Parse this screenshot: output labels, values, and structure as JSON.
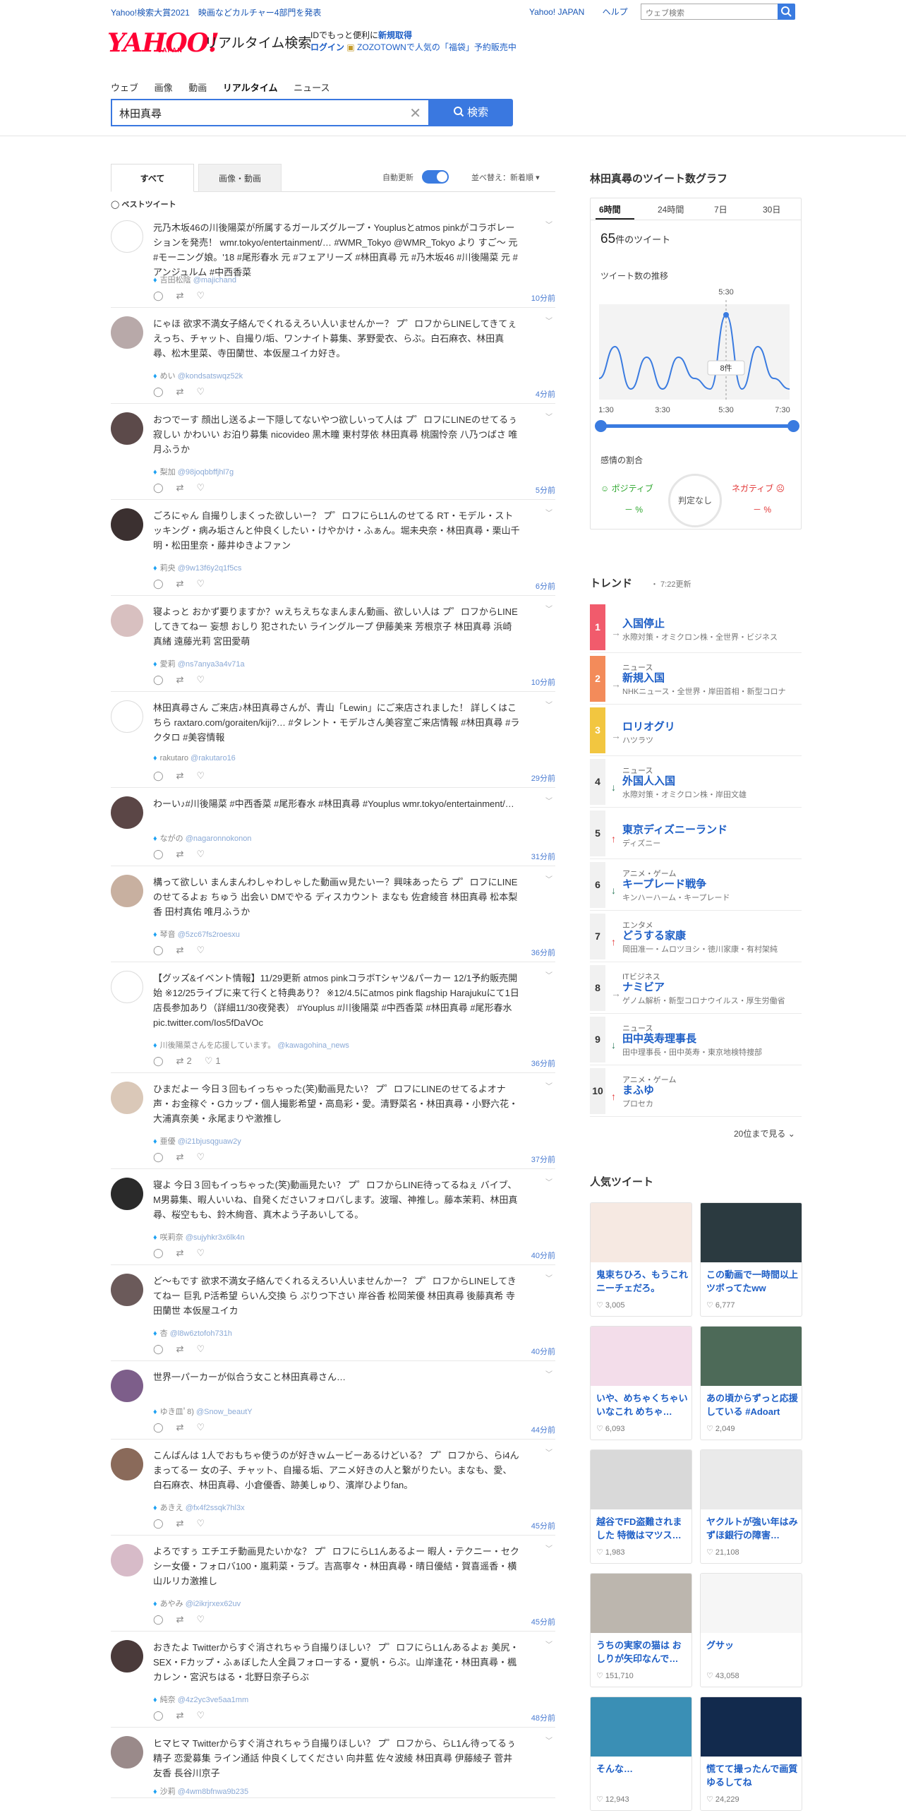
{
  "top": {
    "promo_link": "Yahoo!検索大賞2021　映画などカルチャー4部門を発表",
    "links": [
      "Yahoo! JAPAN",
      "ヘルプ"
    ],
    "web_search_placeholder": "ウェブ検索"
  },
  "header": {
    "logo_text": "YAHOO!",
    "logo_sub": "JAPAN",
    "service_name": "リアルタイム検索",
    "promo_line1": "IDでもっと便利に",
    "promo_line1_link": "新規取得",
    "promo_line2_link": "ログイン",
    "promo_line2": "ZOZOTOWNで人気の「福袋」予約販売中"
  },
  "nav": {
    "tabs": [
      "ウェブ",
      "画像",
      "動画",
      "リアルタイム",
      "ニュース"
    ],
    "active": "リアルタイム"
  },
  "search": {
    "query": "林田真尋",
    "button_label": "検索"
  },
  "feed_controls": {
    "tab_all": "すべて",
    "tab_media": "画像・動画",
    "auto_update": "自動更新",
    "sort": "並べ替え：新着順",
    "best_tweet": "ベストツイート"
  },
  "tweets": [
    {
      "text": "元乃木坂46の川後陽菜が所属するガールズグループ・Youplusとatmos pinkがコラボレーションを発売！ wmr.tokyo/entertainment/… #WMR_Tokyo @WMR_Tokyo より すご～ 元 #モーニング娘。'18 #尾形春水 元 #フェアリーズ #林田真尋 元 #乃木坂46 #川後陽菜 元 #アンジュルム #中西香菜",
      "user": "吉田松陰",
      "screen": "@majichand",
      "time": "10分前",
      "rt": "",
      "like": ""
    },
    {
      "text": "にゃほ 欲求不満女子絡んでくれるえろい人いませんかー？ プ゜ロフからLINEしてきてぇ えっち、チャット、自撮り/垢、ワンナイト募集、茅野愛衣、らぶ。白石麻衣、林田真尋、松木里菜、寺田蘭世、本仮屋ユイカ好き。",
      "user": "めい",
      "screen": "@kondsatswqz52k",
      "time": "4分前",
      "rt": "",
      "like": ""
    },
    {
      "text": "おつでーす 顔出し送るよー下隠してないやつ欲しいって人は プ゜ロフにLINEのせてるぅ 寂しい かわいい お泊り募集 nicovideo 黒木瞳 東村芽依 林田真尋 桃園怜奈 八乃つばさ 唯月ふうか",
      "user": "梨加",
      "screen": "@98joqbbffjhl7g",
      "time": "5分前",
      "rt": "",
      "like": ""
    },
    {
      "text": "ごろにゃん 自撮りしまくった欲しいー？ プ゜ロフにらL1んのせてる RT・モデル・ストッキング・病み垢さんと仲良くしたい・けやかけ・ふぁん。堀未央奈・林田真尋・栗山千明・松田里奈・藤井ゆきよファン",
      "user": "莉央",
      "screen": "@9w13f6y2q1f5cs",
      "time": "6分前",
      "rt": "",
      "like": ""
    },
    {
      "text": "寝よっと おかず要りますか？ｗえちえちなまんまん動画、欲しい人は プ゜ロフからLINEしてきてねー 妄想 おしり 犯されたい ライングループ 伊藤美来 芳根京子 林田真尋 浜崎真緒 遠藤光莉 宮田愛萌",
      "user": "愛莉",
      "screen": "@ns7anya3a4v71a",
      "time": "10分前",
      "rt": "",
      "like": ""
    },
    {
      "text": "林田真尋さん ご来店♪林田真尋さんが、青山「Lewin」にご来店されました！ 詳しくはこちら raxtaro.com/goraiten/kiji?… #タレント・モデルさん美容室ご来店情報 #林田真尋 #ラクタロ #美容情報",
      "user": "rakutaro",
      "screen": "@rakutaro16",
      "time": "29分前",
      "rt": "",
      "like": ""
    },
    {
      "text": "わーい♪#川後陽菜 #中西香菜 #尾形春水 #林田真尋 #Youplus wmr.tokyo/entertainment/…",
      "user": "ながの",
      "screen": "@nagaronnokonon",
      "time": "31分前",
      "rt": "",
      "like": ""
    },
    {
      "text": "構って欲しい まんまんわしゃわしゃした動画ｗ見たいー？興味あったら プ゜ロフにLINEのせてるよぉ ちゅう 出会い DMでやる ディスカウント まなも 佐倉綾音 林田真尋 松本梨香 田村真佑 唯月ふうか",
      "user": "琴音",
      "screen": "@5zc67fs2roesxu",
      "time": "36分前",
      "rt": "",
      "like": ""
    },
    {
      "text": "【グッズ&イベント情報】11/29更新 atmos pinkコラボTシャツ&パーカー 12/1予約販売開始 ※12/25ライブに来て行くと特典あり？ ※12/4.5にatmos pink flagship Harajukuにて1日店長参加あり（詳細11/30夜発表） #Youplus #川後陽菜 #中西香菜 #林田真尋 #尾形春水 pic.twitter.com/Ios5fDaVOc",
      "user": "川後陽菜さんを応援しています。",
      "screen": "@kawagohina_news",
      "time": "36分前",
      "rt": "2",
      "like": "1"
    },
    {
      "text": "ひまだよー 今日３回もイっちゃった(笑)動画見たい？ プ゜ロフにLINEのせてるよオナ声・お金稼ぐ・Gカップ・個人撮影希望・高島彩・愛。清野菜名・林田真尋・小野六花・大浦真奈美・永尾まりや激推し",
      "user": "亜優",
      "screen": "@i21bjusqguaw2y",
      "time": "37分前",
      "rt": "",
      "like": ""
    },
    {
      "text": "寝よ 今日３回もイっちゃった(笑)動画見たい？ プ゜ロフからLINE待ってるねぇ バイブ、M男募集、暇人いいね、自発くださいフォロバします。波瑠、神推し。藤本茉莉、林田真尋、桜空もも、鈴木絢音、真木よう子あいしてる。",
      "user": "咲莉奈",
      "screen": "@sujyhkr3x6lk4n",
      "time": "40分前",
      "rt": "",
      "like": ""
    },
    {
      "text": "ど～もです 欲求不満女子絡んでくれるえろい人いませんかー？ プ゜ロフからLINEしてきてねー 巨乳 P活希望 らいん交換 ら ぷりつ下さい 岸谷香 松岡茉優 林田真尋 後藤真希 寺田蘭世 本仮屋ユイカ",
      "user": "杏",
      "screen": "@l8w6ztofoh731h",
      "time": "40分前",
      "rt": "",
      "like": ""
    },
    {
      "text": "世界一パーカーが似合う女こと林田真尋さん…",
      "user": "ゆき皿ﾟ8)",
      "screen": "@Snow_beautY",
      "time": "44分前",
      "rt": "",
      "like": ""
    },
    {
      "text": "こんばんは 1人でおもちゃ使うのが好きｗムービーあるけどいる？ プ゜ロフから、らi4んまってるー 女の子、チャット、自撮る垢、アニメ好きの人と繋がりたい。まなも、愛、白石麻衣、林田真尋、小倉優香、跡美しゅり、濱岸ひよりfan。",
      "user": "あきえ",
      "screen": "@fx4f2ssqk7hl3x",
      "time": "45分前",
      "rt": "",
      "like": ""
    },
    {
      "text": "よろですぅ エチエチ動画見たいかな？ プ゜ロフにらL1んあるよー 暇人・テクニー・セクシー女優・フォロバ100・嵐莉菜・ラブ。吉高寧々・林田真尋・晴日優結・賀喜遥香・横山ルリカ激推し",
      "user": "あやみ",
      "screen": "@i2ikrjrxex62uv",
      "time": "45分前",
      "rt": "",
      "like": ""
    },
    {
      "text": "おきたよ Twitterからすぐ消されちゃう自撮りほしい？ プ゜ロフにらL1んあるよぉ 美尻・SEX・Fカップ・ふぁぼした人全員フォローする・夏帆・らぶ。山岸逢花・林田真尋・楓カレン・宮沢ちはる・北野日奈子らぶ",
      "user": "純奈",
      "screen": "@4z2yc3ve5aa1mm",
      "time": "48分前",
      "rt": "",
      "like": ""
    },
    {
      "text": "ヒマヒマ Twitterからすぐ消されちゃう自撮りほしい？ プ゜ロフから、らL1ん待ってるぅ 精子 恋愛募集 ライン通話 仲良くしてください 向井藍 佐々波綾 林田真尋 伊藤綾子 菅井友香 長谷川京子",
      "user": "沙莉",
      "screen": "@4wm8bfnwa9b235",
      "time": "",
      "rt": "",
      "like": ""
    }
  ],
  "graph": {
    "title": "林田真尋のツイート数グラフ",
    "tabs": [
      "6時間",
      "24時間",
      "7日",
      "30日"
    ],
    "count_value": "65",
    "count_suffix": "件のツイート",
    "trend_label": "ツイート数の推移",
    "peak_time": "5:30",
    "peak_count": "8件",
    "x_labels": [
      "1:30",
      "3:30",
      "5:30",
      "7:30"
    ],
    "sentiment_label": "感情の割合",
    "positive_label": "ポジティブ",
    "positive_value": "－ %",
    "neutral_label": "判定なし",
    "negative_label": "ネガティブ",
    "negative_value": "－ %",
    "accent_color": "#3a7be0"
  },
  "chart_data": {
    "type": "line",
    "x": [
      "1:30",
      "2:00",
      "2:30",
      "3:00",
      "3:30",
      "4:00",
      "4:30",
      "5:00",
      "5:30",
      "6:00",
      "6:30",
      "7:00",
      "7:30"
    ],
    "values": [
      2,
      5,
      1,
      4,
      1,
      4,
      2,
      1,
      8,
      1,
      5,
      2,
      1
    ],
    "title": "",
    "xlabel": "",
    "ylabel": "",
    "peak": {
      "x": "5:30",
      "y": 8
    }
  },
  "trend": {
    "title": "トレンド",
    "updated": "・ 7:22更新",
    "more": "20位まで見る",
    "items": [
      {
        "rank": "1",
        "arrow": "→",
        "cat": "",
        "name": "入国停止",
        "desc": "水際対策・オミクロン株・全世界・ビジネス",
        "color": "#f15b6c",
        "dir": "flat"
      },
      {
        "rank": "2",
        "arrow": "→",
        "cat": "ニュース",
        "name": "新規入国",
        "desc": "NHKニュース・全世界・岸田首相・新型コロナ",
        "color": "#f38b5a",
        "dir": "flat"
      },
      {
        "rank": "3",
        "arrow": "→",
        "cat": "",
        "name": "ロリオグリ",
        "desc": "ハツラツ",
        "color": "#f2c640",
        "dir": "flat"
      },
      {
        "rank": "4",
        "arrow": "↓",
        "cat": "ニュース",
        "name": "外国人入国",
        "desc": "水際対策・オミクロン株・岸田文雄",
        "color": "#f1f1f1",
        "dir": "down"
      },
      {
        "rank": "5",
        "arrow": "↑",
        "cat": "",
        "name": "東京ディズニーランド",
        "desc": "ディズニー",
        "color": "#f1f1f1",
        "dir": "up"
      },
      {
        "rank": "6",
        "arrow": "↓",
        "cat": "アニメ・ゲーム",
        "name": "キープレード戦争",
        "desc": "キンハーハーム・キープレード",
        "color": "#f1f1f1",
        "dir": "down"
      },
      {
        "rank": "7",
        "arrow": "↑",
        "cat": "エンタメ",
        "name": "どうする家康",
        "desc": "岡田准一・ムロツヨシ・徳川家康・有村架純",
        "color": "#f1f1f1",
        "dir": "up"
      },
      {
        "rank": "8",
        "arrow": "→",
        "cat": "ITビジネス",
        "name": "ナミビア",
        "desc": "ゲノム解析・新型コロナウイルス・厚生労働省",
        "color": "#f1f1f1",
        "dir": "flat"
      },
      {
        "rank": "9",
        "arrow": "↓",
        "cat": "ニュース",
        "name": "田中英寿理事長",
        "desc": "田中理事長・田中英寿・東京地検特捜部",
        "color": "#f1f1f1",
        "dir": "down"
      },
      {
        "rank": "10",
        "arrow": "↑",
        "cat": "アニメ・ゲーム",
        "name": "まふゆ",
        "desc": "プロセカ",
        "color": "#f1f1f1",
        "dir": "up"
      }
    ]
  },
  "popular": {
    "title": "人気ツイート",
    "items": [
      {
        "text": "鬼束ちひろ、もうこれニーチェだろ。",
        "likes": "3,005",
        "bg": "#f6e9e2"
      },
      {
        "text": "この動画で一時間以上ツボってたww",
        "likes": "6,777",
        "bg": "#2b3a40"
      },
      {
        "text": "いや、めちゃくちゃいいなこれ めちゃ…",
        "likes": "6,093",
        "bg": "#f3ddea"
      },
      {
        "text": "あの頃からずっと応援している #Adoart",
        "likes": "2,049",
        "bg": "#4d6a58"
      },
      {
        "text": "越谷でFD盗難されました 特徴はマツス…",
        "likes": "1,983",
        "bg": "#d9d9d9"
      },
      {
        "text": "ヤクルトが強い年はみずほ銀行の障害…",
        "likes": "21,108",
        "bg": "#eaeaea"
      },
      {
        "text": "うちの実家の猫は おしりが矢印なんで…",
        "likes": "151,710",
        "bg": "#bcb6ae"
      },
      {
        "text": "グサッ",
        "likes": "43,058",
        "bg": "#f6f6f6"
      },
      {
        "text": "そんな…",
        "likes": "12,943",
        "bg": "#3a8fb5"
      },
      {
        "text": "慌てて撮ったんで画質ゆるしてね",
        "likes": "24,229",
        "bg": "#122a4d"
      }
    ]
  }
}
